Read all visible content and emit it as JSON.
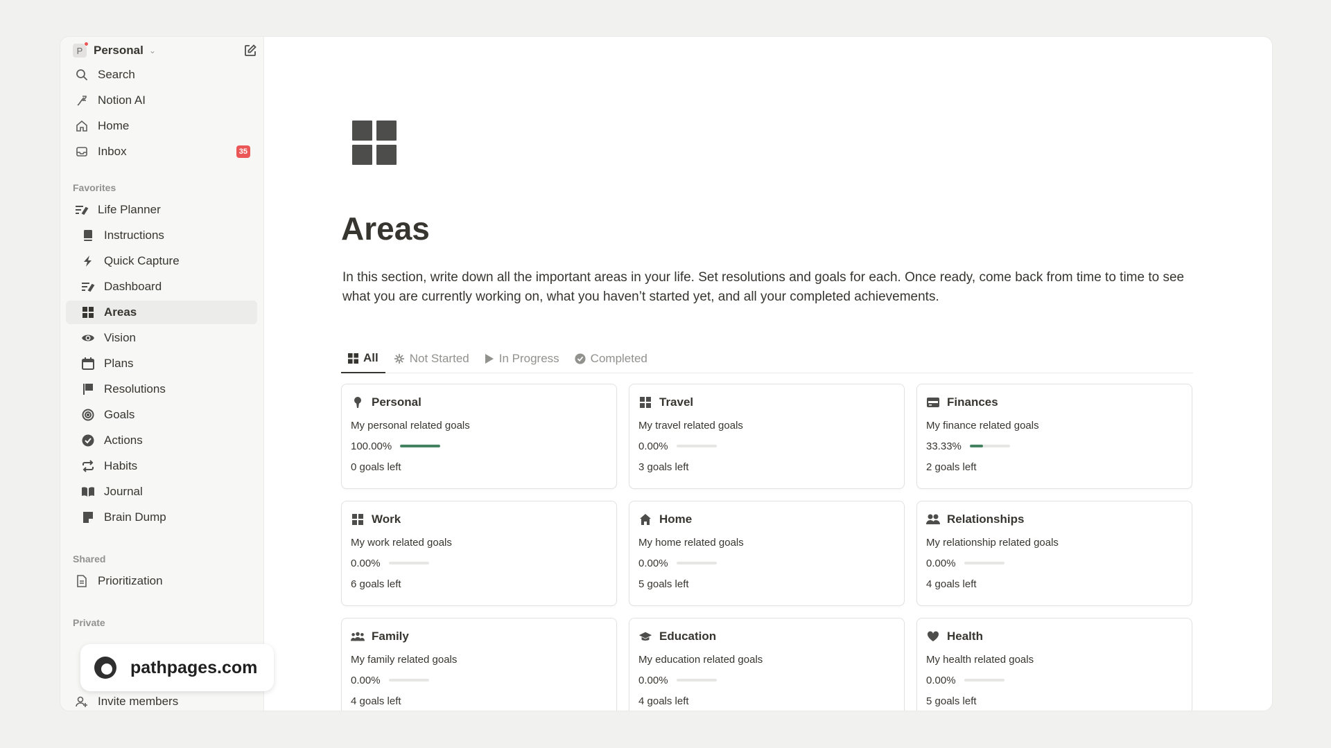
{
  "workspace": {
    "avatar_letter": "P",
    "name": "Personal"
  },
  "nav_top": [
    {
      "label": "Search",
      "icon": "search-icon"
    },
    {
      "label": "Notion AI",
      "icon": "ai-icon"
    },
    {
      "label": "Home",
      "icon": "home-icon"
    },
    {
      "label": "Inbox",
      "icon": "inbox-icon",
      "badge": "35"
    }
  ],
  "favorites": {
    "label": "Favorites",
    "root": {
      "label": "Life Planner",
      "icon": "list-pen-icon"
    },
    "items": [
      {
        "label": "Instructions",
        "icon": "book-icon"
      },
      {
        "label": "Quick Capture",
        "icon": "lightning-icon"
      },
      {
        "label": "Dashboard",
        "icon": "list-pen-icon"
      },
      {
        "label": "Areas",
        "icon": "grid-icon",
        "active": true
      },
      {
        "label": "Vision",
        "icon": "eye-icon"
      },
      {
        "label": "Plans",
        "icon": "calendar-icon"
      },
      {
        "label": "Resolutions",
        "icon": "flag-icon"
      },
      {
        "label": "Goals",
        "icon": "target-icon"
      },
      {
        "label": "Actions",
        "icon": "check-circle-icon"
      },
      {
        "label": "Habits",
        "icon": "repeat-icon"
      },
      {
        "label": "Journal",
        "icon": "open-book-icon"
      },
      {
        "label": "Brain Dump",
        "icon": "note-icon"
      }
    ]
  },
  "shared": {
    "label": "Shared",
    "items": [
      {
        "label": "Prioritization",
        "icon": "page-icon"
      }
    ]
  },
  "private": {
    "label": "Private"
  },
  "invite": {
    "label": "Invite members"
  },
  "page": {
    "title": "Areas",
    "description": "In this section, write down all the important areas in your life. Set resolutions and goals for each. Once ready, come back from time to time to see what you are currently working on, what you haven’t started yet, and all your completed achievements."
  },
  "tabs": [
    {
      "label": "All",
      "icon": "grid-icon",
      "active": true
    },
    {
      "label": "Not Started",
      "icon": "asterisk-icon"
    },
    {
      "label": "In Progress",
      "icon": "play-icon"
    },
    {
      "label": "Completed",
      "icon": "check-circle-icon"
    }
  ],
  "cards": [
    {
      "title": "Personal",
      "icon": "person-icon",
      "subtitle": "My personal related goals",
      "progress_text": "100.00%",
      "progress": 1.0,
      "goals_left": "0 goals left"
    },
    {
      "title": "Travel",
      "icon": "grid-icon",
      "subtitle": "My travel related goals",
      "progress_text": "0.00%",
      "progress": 0.0,
      "goals_left": "3 goals left"
    },
    {
      "title": "Finances",
      "icon": "card-icon",
      "subtitle": "My finance related goals",
      "progress_text": "33.33%",
      "progress": 0.3333,
      "goals_left": "2 goals left"
    },
    {
      "title": "Work",
      "icon": "grid-icon",
      "subtitle": "My work related goals",
      "progress_text": "0.00%",
      "progress": 0.0,
      "goals_left": "6 goals left"
    },
    {
      "title": "Home",
      "icon": "house-icon",
      "subtitle": "My home related goals",
      "progress_text": "0.00%",
      "progress": 0.0,
      "goals_left": "5 goals left"
    },
    {
      "title": "Relationships",
      "icon": "people-icon",
      "subtitle": "My relationship related goals",
      "progress_text": "0.00%",
      "progress": 0.0,
      "goals_left": "4 goals left"
    },
    {
      "title": "Family",
      "icon": "group-icon",
      "subtitle": "My family related goals",
      "progress_text": "0.00%",
      "progress": 0.0,
      "goals_left": "4 goals left"
    },
    {
      "title": "Education",
      "icon": "graduation-cap-icon",
      "subtitle": "My education related goals",
      "progress_text": "0.00%",
      "progress": 0.0,
      "goals_left": "4 goals left"
    },
    {
      "title": "Health",
      "icon": "heart-icon",
      "subtitle": "My health related goals",
      "progress_text": "0.00%",
      "progress": 0.0,
      "goals_left": "5 goals left"
    }
  ],
  "watermark": {
    "text": "pathpages.com"
  },
  "colors": {
    "progress_fill": "#448361",
    "badge": "#eb5757"
  }
}
